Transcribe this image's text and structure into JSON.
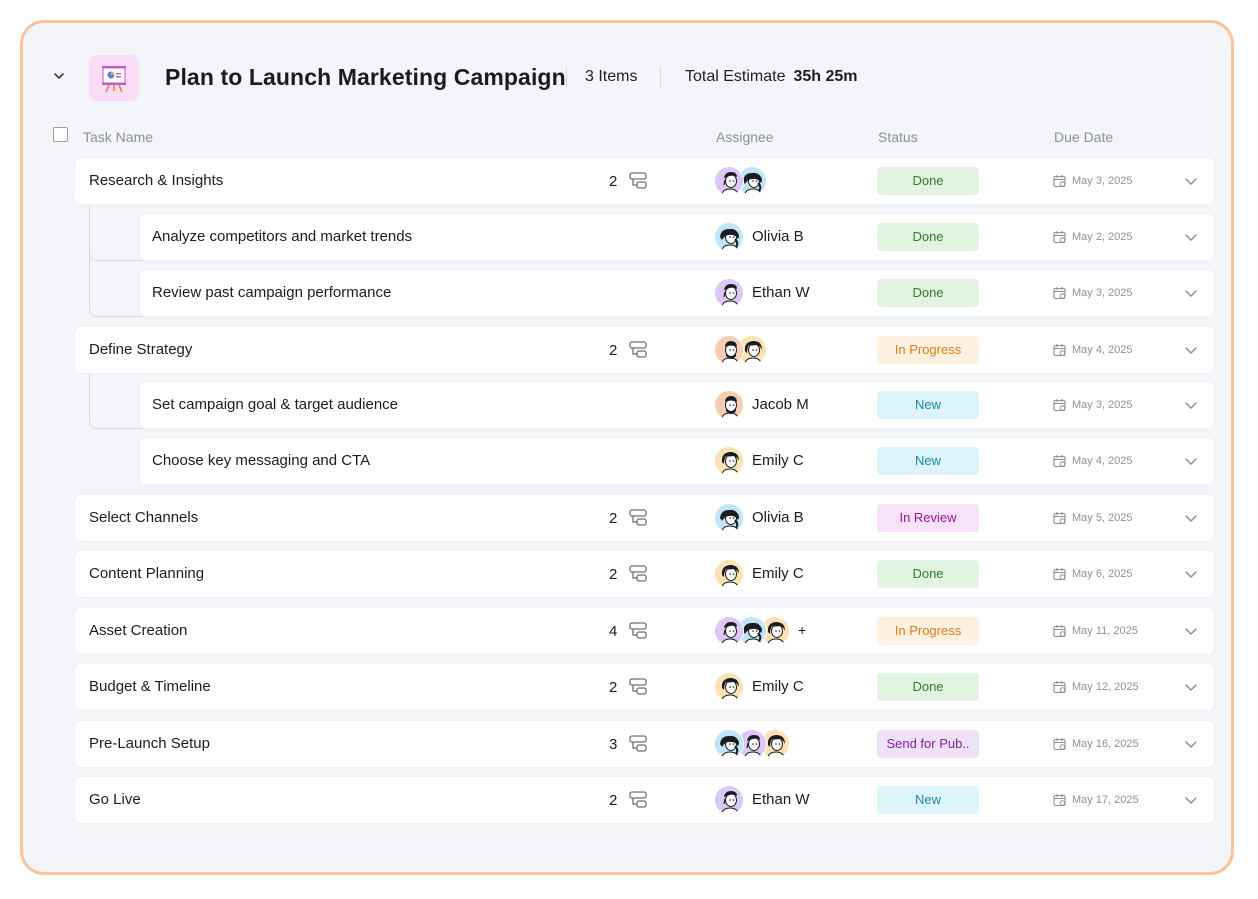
{
  "project": {
    "title": "Plan to Launch Marketing Campaign",
    "items_count": "3 Items",
    "estimate_label": "Total Estimate",
    "estimate_value": "35h 25m",
    "icon": "presentation-board-icon"
  },
  "columns": {
    "task_name": "Task Name",
    "assignee": "Assignee",
    "status": "Status",
    "due_date": "Due Date"
  },
  "colors": {
    "card_border": "#f9c49b",
    "done": "#2e7d32",
    "in_progress": "#e07a12",
    "new": "#1b8aa8",
    "in_review": "#a010a8",
    "send_for_pub": "#8a1aa8"
  },
  "tasks": [
    {
      "name": "Research & Insights",
      "count": "2",
      "assignees": [
        "Ethan W",
        "Olivia B"
      ],
      "assignee_label": "",
      "status": "Done",
      "due": "May 3, 2025"
    },
    {
      "name": "Analyze competitors and market trends",
      "sub": true,
      "assignee_label": "Olivia B",
      "status": "Done",
      "due": "May 2, 2025"
    },
    {
      "name": "Review past campaign performance",
      "sub": true,
      "assignee_label": "Ethan W",
      "status": "Done",
      "due": "May 3, 2025"
    },
    {
      "name": "Define Strategy",
      "count": "2",
      "assignees": [
        "Jacob M",
        "Emily C"
      ],
      "assignee_label": "",
      "status": "In Progress",
      "due": "May 4, 2025"
    },
    {
      "name": "Set campaign goal & target audience",
      "sub": true,
      "assignee_label": "Jacob M",
      "status": "New",
      "due": "May 3, 2025"
    },
    {
      "name": "Choose key messaging and CTA",
      "sub": true,
      "assignee_label": "Emily C",
      "status": "New",
      "due": "May 4, 2025"
    },
    {
      "name": "Select Channels",
      "count": "2",
      "assignee_label": "Olivia B",
      "status": "In Review",
      "due": "May 5, 2025"
    },
    {
      "name": "Content Planning",
      "count": "2",
      "assignee_label": "Emily C",
      "status": "Done",
      "due": "May 6, 2025"
    },
    {
      "name": "Asset Creation",
      "count": "4",
      "assignees": [
        "Ethan W",
        "Olivia B",
        "Emily C"
      ],
      "more": "+",
      "assignee_label": "",
      "status": "In Progress",
      "due": "May 11, 2025"
    },
    {
      "name": "Budget & Timeline",
      "count": "2",
      "assignee_label": "Emily C",
      "status": "Done",
      "due": "May 12, 2025"
    },
    {
      "name": "Pre-Launch Setup",
      "count": "3",
      "assignees": [
        "Olivia B",
        "Ethan W",
        "Emily C"
      ],
      "assignee_label": "",
      "status": "Send for Pub..",
      "due": "May 16, 2025"
    },
    {
      "name": "Go Live",
      "count": "2",
      "assignee_label": "Ethan W",
      "status": "New",
      "due": "May 17, 2025"
    }
  ]
}
